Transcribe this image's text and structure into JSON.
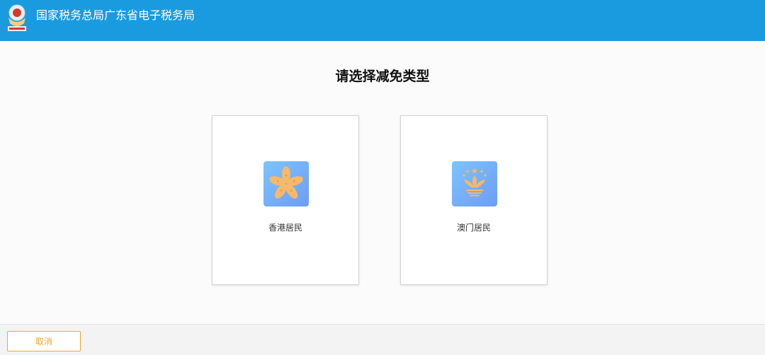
{
  "header": {
    "title": "国家税务总局广东省电子税务局",
    "logo_icon": "tax-emblem-icon",
    "background_color": "#1a9be0"
  },
  "main": {
    "title": "请选择减免类型",
    "options": [
      {
        "label": "香港居民",
        "icon": "bauhinia-flower-icon"
      },
      {
        "label": "澳门居民",
        "icon": "lotus-flower-icon"
      }
    ]
  },
  "footer": {
    "cancel_label": "取消",
    "accent_color": "#f5a623"
  }
}
